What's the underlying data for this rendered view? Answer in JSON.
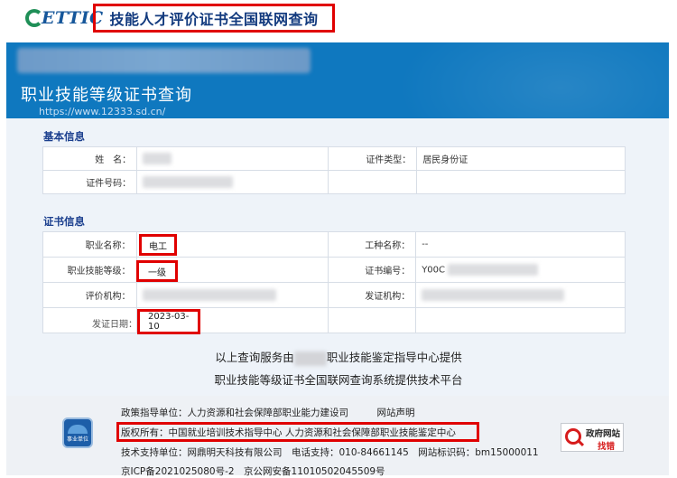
{
  "header": {
    "logo_text": "ETTIC",
    "site_title": "技能人才评价证书全国联网查询"
  },
  "banner": {
    "title": "职业技能等级证书查询",
    "url": "https://www.12333.sd.cn/"
  },
  "basic": {
    "section_title": "基本信息",
    "name_label": "姓　名：",
    "name_value": "",
    "id_type_label": "证件类型：",
    "id_type_value": "居民身份证",
    "id_no_label": "证件号码：",
    "id_no_value": ""
  },
  "cert": {
    "section_title": "证书信息",
    "occupation_label": "职业名称：",
    "occupation_value": "电工",
    "job_type_label": "工种名称：",
    "job_type_value": "--",
    "level_label": "职业技能等级：",
    "level_value": "一级",
    "cert_no_label": "证书编号：",
    "cert_no_value": "Y00C",
    "eval_org_label": "评价机构：",
    "issue_org_label": "发证机构：",
    "issue_date_label": "发证日期：",
    "issue_date_value": "2023-03-10"
  },
  "provider": {
    "line1_a": "以上查询服务由",
    "line1_b": "职业技能鉴定指导中心提供",
    "line2": "职业技能等级证书全国联网查询系统提供技术平台"
  },
  "footer": {
    "policy": "政策指导单位：人力资源和社会保障部职业能力建设司　　　网站声明",
    "copyright": "版权所有：中国就业培训技术指导中心  人力资源和社会保障部职业技能鉴定中心",
    "support": "技术支持单位：网鼎明天科技有限公司　电话支持：010-84661145　网站标识码：bm15000011",
    "icp": "京ICP备2021025080号-2　京公网安备11010502045509号",
    "badge_label": "事业单位",
    "gov_line1": "政府网站",
    "gov_line2": "找错"
  }
}
